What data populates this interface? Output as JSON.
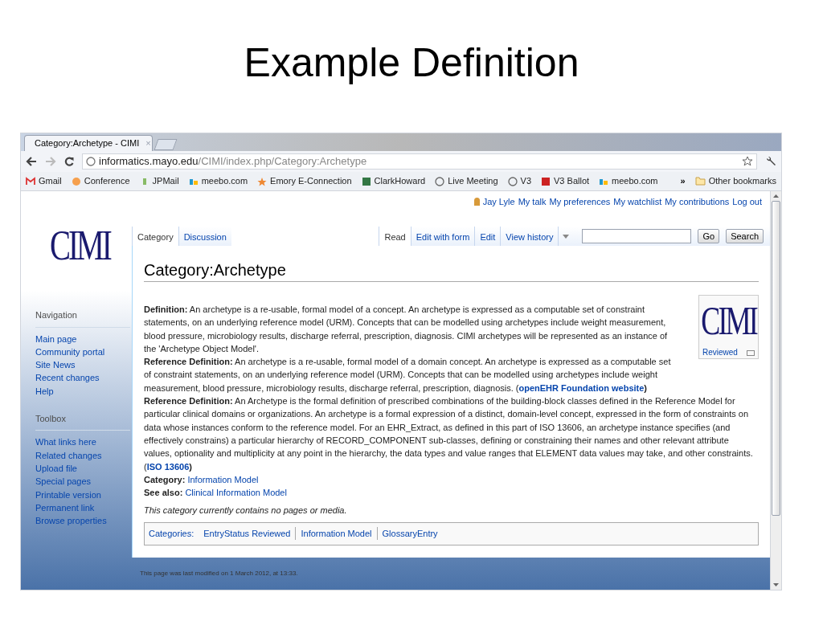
{
  "slide": {
    "title": "Example Definition"
  },
  "browser": {
    "tab": {
      "title": "Category:Archetype - CIMI",
      "close": "×"
    },
    "address": {
      "host": "informatics.mayo.edu",
      "path": "/CIMI/index.php/Category:Archetype"
    },
    "bookmarks": [
      {
        "label": "Gmail"
      },
      {
        "label": "Conference"
      },
      {
        "label": "JPMail"
      },
      {
        "label": "meebo.com"
      },
      {
        "label": "Emory E-Connection"
      },
      {
        "label": "ClarkHoward"
      },
      {
        "label": "Live Meeting"
      },
      {
        "label": "V3"
      },
      {
        "label": "V3 Ballot"
      },
      {
        "label": "meebo.com"
      }
    ],
    "bookmarks_more": "»",
    "other_bookmarks": "Other bookmarks"
  },
  "wiki": {
    "logo": "CIMI",
    "personal": [
      "Jay Lyle",
      "My talk",
      "My preferences",
      "My watchlist",
      "My contributions",
      "Log out"
    ],
    "left_tabs": [
      {
        "label": "Category",
        "selected": true
      },
      {
        "label": "Discussion",
        "selected": false
      }
    ],
    "right_tabs": [
      {
        "label": "Read",
        "selected": true
      },
      {
        "label": "Edit with form",
        "selected": false
      },
      {
        "label": "Edit",
        "selected": false
      },
      {
        "label": "View history",
        "selected": false
      }
    ],
    "search": {
      "go": "Go",
      "search": "Search"
    },
    "sidebar": [
      {
        "heading": "Navigation",
        "items": [
          "Main page",
          "Community portal",
          "Site News",
          "Recent changes",
          "Help"
        ]
      },
      {
        "heading": "Toolbox",
        "items": [
          "What links here",
          "Related changes",
          "Upload file",
          "Special pages",
          "Printable version",
          "Permanent link",
          "Browse properties"
        ]
      }
    ],
    "heading": "Category:Archetype",
    "image_box": {
      "logo": "CIMI",
      "caption": "Reviewed"
    },
    "paragraphs": [
      {
        "label": "Definition:",
        "text": "An archetype is a re-usable, formal model of a concept. An archetype is expressed as a computable set of constraint statements, on an underlying reference model (URM). Concepts that can be modelled using archetypes include weight measurement, blood pressure, microbiology results, discharge referral, prescription, diagnosis. CIMI archetypes will be represented as an instance of the 'Archetype Object Model'."
      },
      {
        "label": "Reference Definition:",
        "text": "An archetype is a re-usable, formal model of a domain concept. An archetype is expressed as a computable set of constraint statements, on an underlying reference model (URM). Concepts that can be modelled using archetypes include weight measurement, blood pressure, microbiology results, discharge referral, prescription, diagnosis. (",
        "link": "openEHR Foundation website",
        "after": ")"
      },
      {
        "label": "Reference Definition:",
        "text": "An Archetype is the formal definition of prescribed combinations of the building-block classes defined in the Reference Model for particular clinical domains or organizations. An archetype is a formal expression of a distinct, domain-level concept, expressed in the form of constraints on data whose instances conform to the reference model. For an EHR_Extract, as defined in this part of ISO 13606, an archetype instance specifies (and effectively constrains) a particular hierarchy of RECORD_COMPONENT sub-classes, defining or constraining their names and other relevant attribute values, optionality and multiplicity at any point in the hierarchy, the data types and value ranges that ELEMENT data values may take, and other constraints. (",
        "link": "ISO 13606",
        "after": ")"
      },
      {
        "label": "Category:",
        "plain_link": "Information Model"
      },
      {
        "label": "See also:",
        "plain_link": "Clinical Information Model"
      }
    ],
    "empty_note": "This category currently contains no pages or media.",
    "categories": {
      "label": "Categories:",
      "links": [
        "EntryStatus Reviewed",
        "Information Model",
        "GlossaryEntry"
      ]
    },
    "footer": "This page was last modified on 1 March 2012, at 13:33."
  }
}
